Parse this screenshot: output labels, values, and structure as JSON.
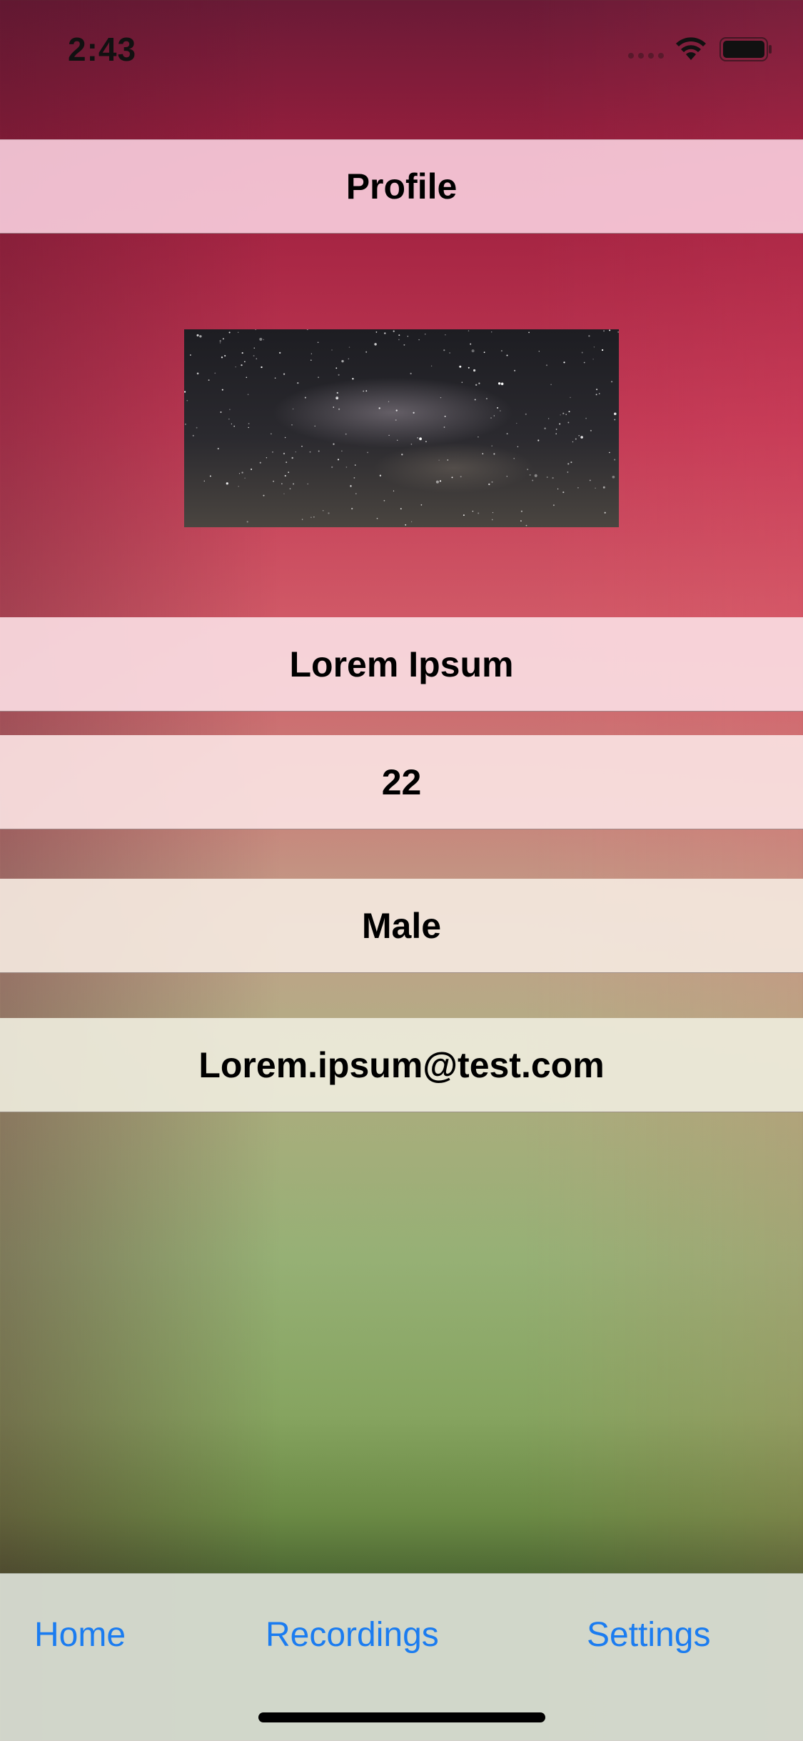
{
  "status_bar": {
    "time": "2:43",
    "icons": [
      "signal-dots-icon",
      "wifi-icon",
      "battery-icon"
    ]
  },
  "nav_bar": {
    "title": "Profile"
  },
  "profile": {
    "image": "starry-night-sky-photo",
    "name": "Lorem Ipsum",
    "age": "22",
    "gender": "Male",
    "email": "Lorem.ipsum@test.com"
  },
  "tab_bar": {
    "items": [
      {
        "label": "Home"
      },
      {
        "label": "Recordings"
      },
      {
        "label": "Settings"
      }
    ],
    "tint_color": "#1b7cf0"
  },
  "colors": {
    "gradient_top": "#6a1a36",
    "gradient_mid": "#c23a55",
    "gradient_bottom": "#6b8a45"
  }
}
